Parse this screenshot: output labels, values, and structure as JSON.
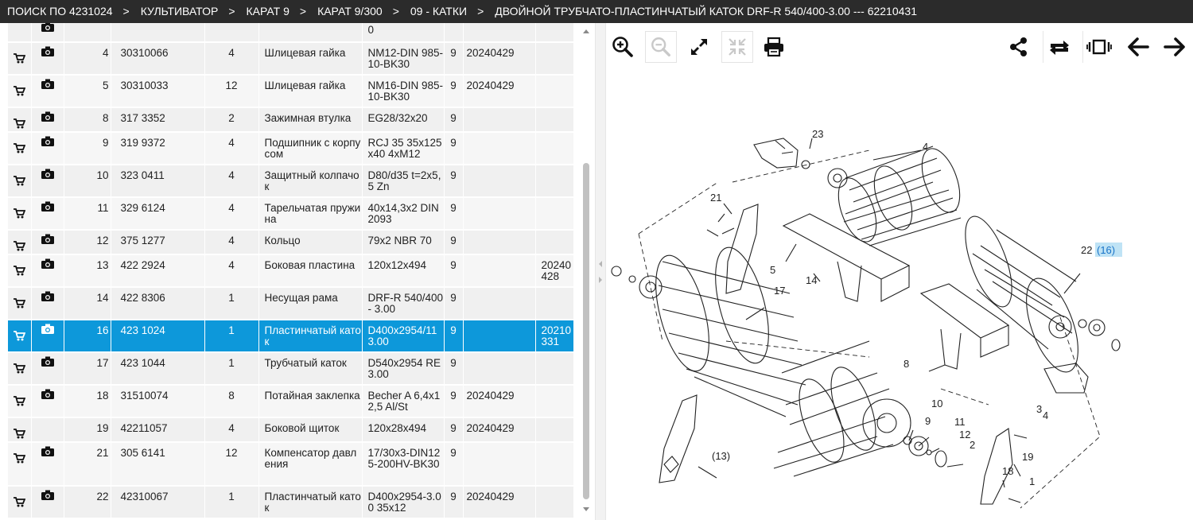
{
  "breadcrumbs": [
    "ПОИСК ПО 4231024",
    "КУЛЬТИВАТОР",
    "КАРАТ 9",
    "КАРАТ 9/300",
    "09 - КАТКИ",
    "ДВОЙНОЙ ТРУБЧАТО-ПЛАСТИНЧАТЫЙ КАТОК DRF-R 540/400-3.00 --- 62210431"
  ],
  "breadcrumb_separator": ">",
  "top_partial_row": {
    "spec": "0"
  },
  "rows": [
    {
      "pos": "4",
      "article": "30310066",
      "qty": "4",
      "name": "Шлицевая гайка",
      "spec": "NM12-DIN 985-10-BK30",
      "unit": "9",
      "date": "20240429",
      "date2": "",
      "camera": true,
      "selected": false
    },
    {
      "pos": "5",
      "article": "30310033",
      "qty": "12",
      "name": "Шлицевая гайка",
      "spec": "NM16-DIN 985-10-BK30",
      "unit": "9",
      "date": "20240429",
      "date2": "",
      "camera": true,
      "selected": false
    },
    {
      "pos": "8",
      "article": "317 3352",
      "qty": "2",
      "name": "Зажимная втулка",
      "spec": "EG28/32x20",
      "unit": "9",
      "date": "",
      "date2": "",
      "camera": true,
      "selected": false
    },
    {
      "pos": "9",
      "article": "319 9372",
      "qty": "4",
      "name": "Подшипник с корпусом",
      "spec": "RCJ 35 35x125x40 4xM12",
      "unit": "9",
      "date": "",
      "date2": "",
      "camera": true,
      "selected": false
    },
    {
      "pos": "10",
      "article": "323 0411",
      "qty": "4",
      "name": "Защитный колпачок",
      "spec": "D80/d35 t=2x5,5 Zn",
      "unit": "9",
      "date": "",
      "date2": "",
      "camera": true,
      "selected": false
    },
    {
      "pos": "11",
      "article": "329 6124",
      "qty": "4",
      "name": "Тарельчатая пружина",
      "spec": "40x14,3x2 DIN2093",
      "unit": "9",
      "date": "",
      "date2": "",
      "camera": true,
      "selected": false
    },
    {
      "pos": "12",
      "article": "375 1277",
      "qty": "4",
      "name": "Кольцо",
      "spec": "79x2 NBR 70",
      "unit": "9",
      "date": "",
      "date2": "",
      "camera": true,
      "selected": false
    },
    {
      "pos": "13",
      "article": "422 2924",
      "qty": "4",
      "name": "Боковая пластина",
      "spec": "120x12x494",
      "unit": "9",
      "date": "",
      "date2": "20240428",
      "camera": true,
      "selected": false
    },
    {
      "pos": "14",
      "article": "422 8306",
      "qty": "1",
      "name": "Несущая рама",
      "spec": "DRF-R 540/400 - 3.00",
      "unit": "9",
      "date": "",
      "date2": "",
      "camera": true,
      "selected": false
    },
    {
      "pos": "16",
      "article": "423 1024",
      "qty": "1",
      "name": "Пластинчатый каток",
      "spec": "D400x2954/11 3.00",
      "unit": "9",
      "date": "",
      "date2": "20210331",
      "camera": true,
      "selected": true
    },
    {
      "pos": "17",
      "article": "423 1044",
      "qty": "1",
      "name": "Трубчатый каток",
      "spec": "D540x2954 RE 3.00",
      "unit": "9",
      "date": "",
      "date2": "",
      "camera": true,
      "selected": false
    },
    {
      "pos": "18",
      "article": "31510074",
      "qty": "8",
      "name": "Потайная заклепка",
      "spec": "Becher A 6,4x12,5 Al/St",
      "unit": "9",
      "date": "20240429",
      "date2": "",
      "camera": true,
      "selected": false
    },
    {
      "pos": "19",
      "article": "42211057",
      "qty": "4",
      "name": "Боковой щиток",
      "spec": "120x28x494",
      "unit": "9",
      "date": "20240429",
      "date2": "",
      "camera": false,
      "selected": false
    },
    {
      "pos": "21",
      "article": "305 6141",
      "qty": "12",
      "name": "Компенсатор давления",
      "spec": "17/30x3-DIN125-200HV-BK30",
      "unit": "9",
      "date": "",
      "date2": "",
      "camera": true,
      "selected": false
    },
    {
      "pos": "22",
      "article": "42310067",
      "qty": "1",
      "name": "Пластинчатый каток",
      "spec": "D400x2954-3.00 35x12",
      "unit": "9",
      "date": "20240429",
      "date2": "",
      "camera": true,
      "selected": false
    }
  ],
  "toolbar": {
    "zoom_in": "zoom-in-icon",
    "zoom_out": "zoom-out-icon",
    "expand": "expand-icon",
    "fit": "fit-icon",
    "print": "print-icon",
    "share": "share-icon",
    "rotate": "rotate-icon",
    "fullscreen": "fullscreen-icon",
    "prev": "arrow-left-icon",
    "next": "arrow-right-icon"
  },
  "diagram_labels": {
    "l23": "23",
    "l4": "4",
    "l21": "21",
    "l5": "5",
    "l14": "14",
    "l17": "17",
    "l22": "22",
    "l22b": "(16)",
    "l8": "8",
    "l10": "10",
    "l9": "9",
    "l11": "11",
    "l12": "12",
    "l2": "2",
    "l3": "3",
    "l4b": "4",
    "l19": "19",
    "l18": "18",
    "l1": "1",
    "l13": "(13)"
  },
  "colors": {
    "header_bg": "#2b2b2b",
    "selected_row": "#0d98da",
    "highlight_label": "#1a74c9"
  }
}
